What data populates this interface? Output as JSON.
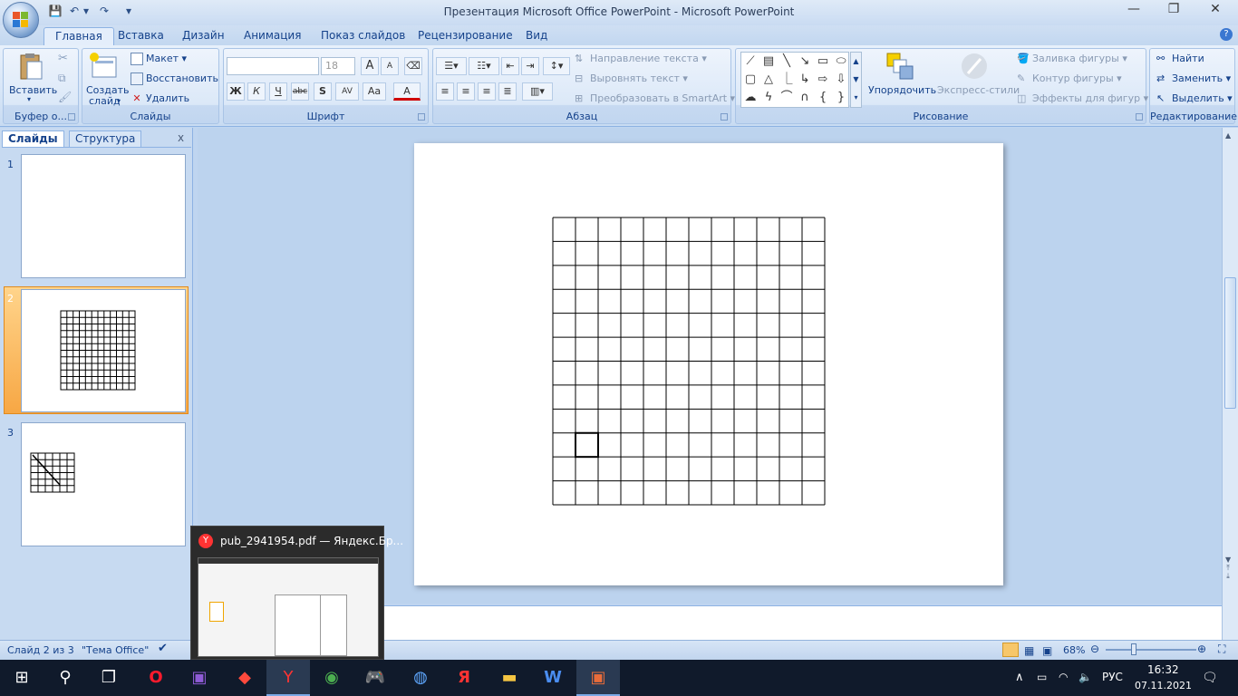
{
  "window": {
    "title": "Презентация Microsoft Office PowerPoint - Microsoft PowerPoint",
    "minimize": "—",
    "restore": "❐",
    "close": "✕"
  },
  "qat": {
    "save": "💾",
    "undo": "↶",
    "undo_dd": "▾",
    "redo": "↷",
    "customize": "▾"
  },
  "tabs": [
    "Главная",
    "Вставка",
    "Дизайн",
    "Анимация",
    "Показ слайдов",
    "Рецензирование",
    "Вид"
  ],
  "help": "?",
  "ribbon": {
    "clipboard": {
      "label": "Буфер о...",
      "paste": "Вставить",
      "paste_dd": "▾"
    },
    "slides": {
      "label": "Слайды",
      "new_slide_1": "Создать",
      "new_slide_2": "слайд",
      "new_slide_dd": "▾",
      "layout": "Макет",
      "reset": "Восстановить",
      "delete": "Удалить"
    },
    "font": {
      "label": "Шрифт",
      "font_name": "",
      "font_size": "18",
      "bold": "Ж",
      "italic": "К",
      "underline": "Ч",
      "strike": "abc",
      "shadow": "S",
      "spacing": "AV",
      "case": "Aa",
      "color": "A",
      "grow": "A",
      "shrink": "A"
    },
    "paragraph": {
      "label": "Абзац",
      "text_direction": "Направление текста",
      "align_text": "Выровнять текст",
      "smartart": "Преобразовать в SmartArt"
    },
    "drawing": {
      "label": "Рисование",
      "arrange": "Упорядочить",
      "quick_styles": "Экспресс-стили",
      "fill": "Заливка фигуры",
      "outline": "Контур фигуры",
      "effects": "Эффекты для фигур"
    },
    "editing": {
      "label": "Редактирование",
      "find": "Найти",
      "replace": "Заменить",
      "select": "Выделить"
    }
  },
  "panel": {
    "tab_slides": "Слайды",
    "tab_outline": "Структура",
    "close": "x"
  },
  "slides": [
    {
      "num": "1"
    },
    {
      "num": "2"
    },
    {
      "num": "3"
    }
  ],
  "status": {
    "slide": "Слайд 2 из 3",
    "theme": "\"Тема Office\"",
    "zoom": "68%"
  },
  "preview": {
    "title": "pub_2941954.pdf — Яндекс.Бр..."
  },
  "tray": {
    "lang": "РУС",
    "time": "16:32",
    "date": "07.11.2021"
  },
  "colors": {
    "ribbon": "#dbe8f8",
    "accent": "#f7a744",
    "taskbar": "#101a2b"
  }
}
